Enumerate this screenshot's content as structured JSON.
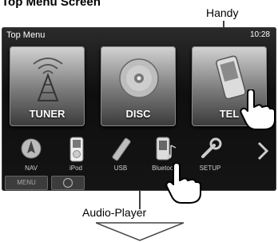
{
  "heading": "Top Menu Screen",
  "callouts": {
    "handy": "Handy",
    "audio_player": "Audio-Player"
  },
  "screen": {
    "title": "Top Menu",
    "clock": "10:28",
    "tiles": [
      {
        "label": "TUNER",
        "icon": "tuner-antenna-icon"
      },
      {
        "label": "DISC",
        "icon": "disc-icon"
      },
      {
        "label": "TEL",
        "icon": "phone-icon"
      }
    ],
    "sources": [
      {
        "label": "NAV",
        "icon": "nav-icon"
      },
      {
        "label": "iPod",
        "icon": "ipod-icon"
      },
      {
        "label": "USB",
        "icon": "usb-icon"
      },
      {
        "label": "Bluetooth",
        "icon": "bluetooth-audio-icon"
      },
      {
        "label": "SETUP",
        "icon": "setup-icon"
      }
    ],
    "memo_button": "MENU"
  },
  "colors": {
    "screen_bg": "#141414",
    "tile_top": "#d3d3d3",
    "tile_bottom": "#3a3a3a"
  }
}
